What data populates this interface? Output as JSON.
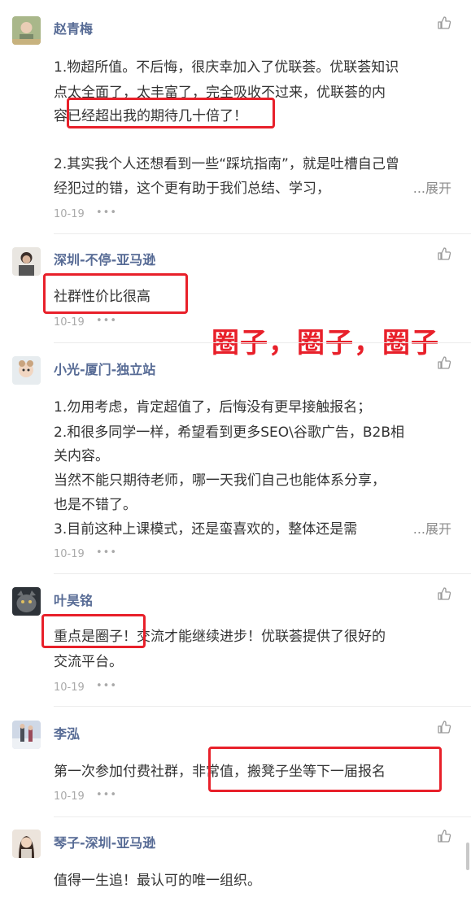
{
  "comments": [
    {
      "name": "赵青梅",
      "lines": [
        "1.物超所值。不后悔，很庆幸加入了优联荟。优联荟知识",
        "点太全面了，太丰富了，完全吸收不过来，优联荟的内",
        "容已经超出我的期待几十倍了！",
        "",
        "2.其实我个人还想看到一些“踩坑指南”，就是吐槽自己曾",
        "经犯过的错，这个更有助于我们总结、学习，"
      ],
      "expand": "...展开",
      "date": "10-19",
      "more": "•••"
    },
    {
      "name": "深圳-不停-亚马逊",
      "lines": [
        "社群性价比很高"
      ],
      "date": "10-19",
      "more": "•••"
    },
    {
      "name": "小光-厦门-独立站",
      "lines": [
        "1.勿用考虑，肯定超值了，后悔没有更早接触报名；",
        "2.和很多同学一样，希望看到更多SEO\\谷歌广告，B2B相",
        "关内容。",
        "当然不能只期待老师，哪一天我们自己也能体系分享，",
        "也是不错了。",
        "3.目前这种上课模式，还是蛮喜欢的，整体还是需"
      ],
      "expand": "...展开",
      "date": "10-19",
      "more": "•••"
    },
    {
      "name": "叶昊铭",
      "lines": [
        "重点是圈子！交流才能继续进步！优联荟提供了很好的",
        "交流平台。"
      ],
      "date": "10-19",
      "more": "•••"
    },
    {
      "name": "李泓",
      "lines": [
        "第一次参加付费社群，非常值，搬凳子坐等下一届报名"
      ],
      "date": "10-19",
      "more": "•••"
    },
    {
      "name": "琴子-深圳-亚马逊",
      "lines": [
        "值得一生追！最认可的唯一组织。"
      ]
    }
  ],
  "annotation": "圈子，圈子，圈子",
  "colors": {
    "name": "#576b95",
    "highlight": "#e8202a",
    "meta": "#aaaaaa"
  }
}
